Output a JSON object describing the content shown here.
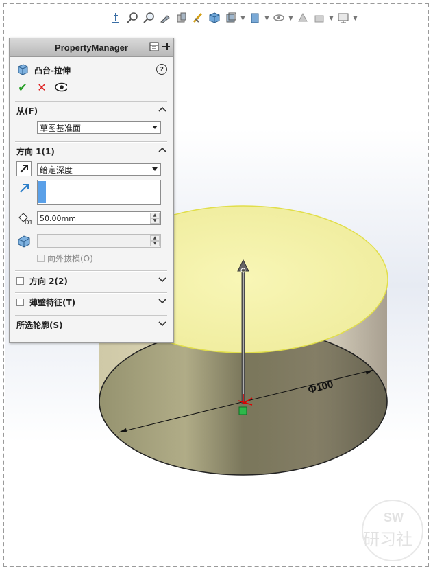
{
  "property_manager": {
    "title": "PropertyManager",
    "feature_name": "凸台-拉伸",
    "sections": {
      "from": {
        "label": "从(F)",
        "value": "草图基准面"
      },
      "direction1": {
        "label": "方向 1(1)",
        "end_condition": "给定深度",
        "depth_value": "50.00mm",
        "draft_outward_label": "向外拔模(O)"
      },
      "direction2": {
        "label": "方向 2(2)"
      },
      "thin_feature": {
        "label": "薄壁特征(T)"
      },
      "selected_contours": {
        "label": "所选轮廓(S)"
      }
    }
  },
  "model": {
    "dimension_label": "Φ100",
    "colors": {
      "top_face": "#f5f3a8",
      "side_light": "#c7c0a6",
      "bottom_face": "#8a8763",
      "drag_arrow": "#555555",
      "origin": "#2db84a"
    }
  },
  "toolbar": {
    "icons": [
      "view-orientation-icon",
      "zoom-to-fit-icon",
      "zoom-area-icon",
      "previous-view-icon",
      "section-view-icon",
      "dynamic-annotation-icon",
      "view-cube-icon",
      "display-style-icon",
      "hide-show-icon",
      "appearance-icon",
      "scene-icon",
      "view-settings-icon"
    ]
  }
}
